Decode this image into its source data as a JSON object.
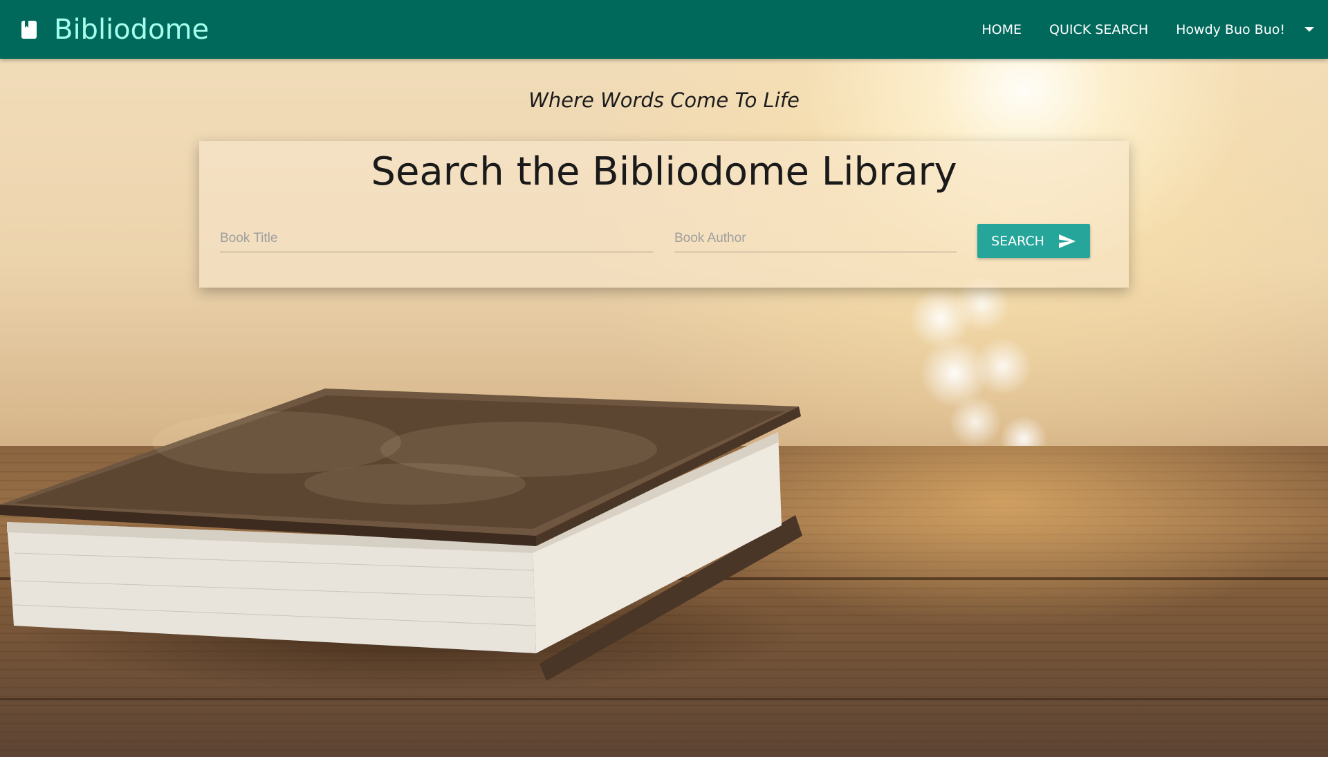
{
  "brand": {
    "name": "Bibliodome",
    "icon": "book-icon",
    "color": "#a7ffeb"
  },
  "navbar": {
    "background": "#00695c",
    "links": [
      {
        "label": "HOME"
      },
      {
        "label": "QUICK SEARCH"
      },
      {
        "label": "Howdy Buo Buo!"
      }
    ],
    "dropdown_icon": "caret-down-icon"
  },
  "tagline": "Where Words Come To Life",
  "search": {
    "title": "Search the Bibliodome Library",
    "title_placeholder": "Book Title",
    "title_value": "",
    "author_placeholder": "Book Author",
    "author_value": "",
    "button_label": "SEARCH",
    "button_icon": "send-icon",
    "button_color": "#26a69a"
  }
}
